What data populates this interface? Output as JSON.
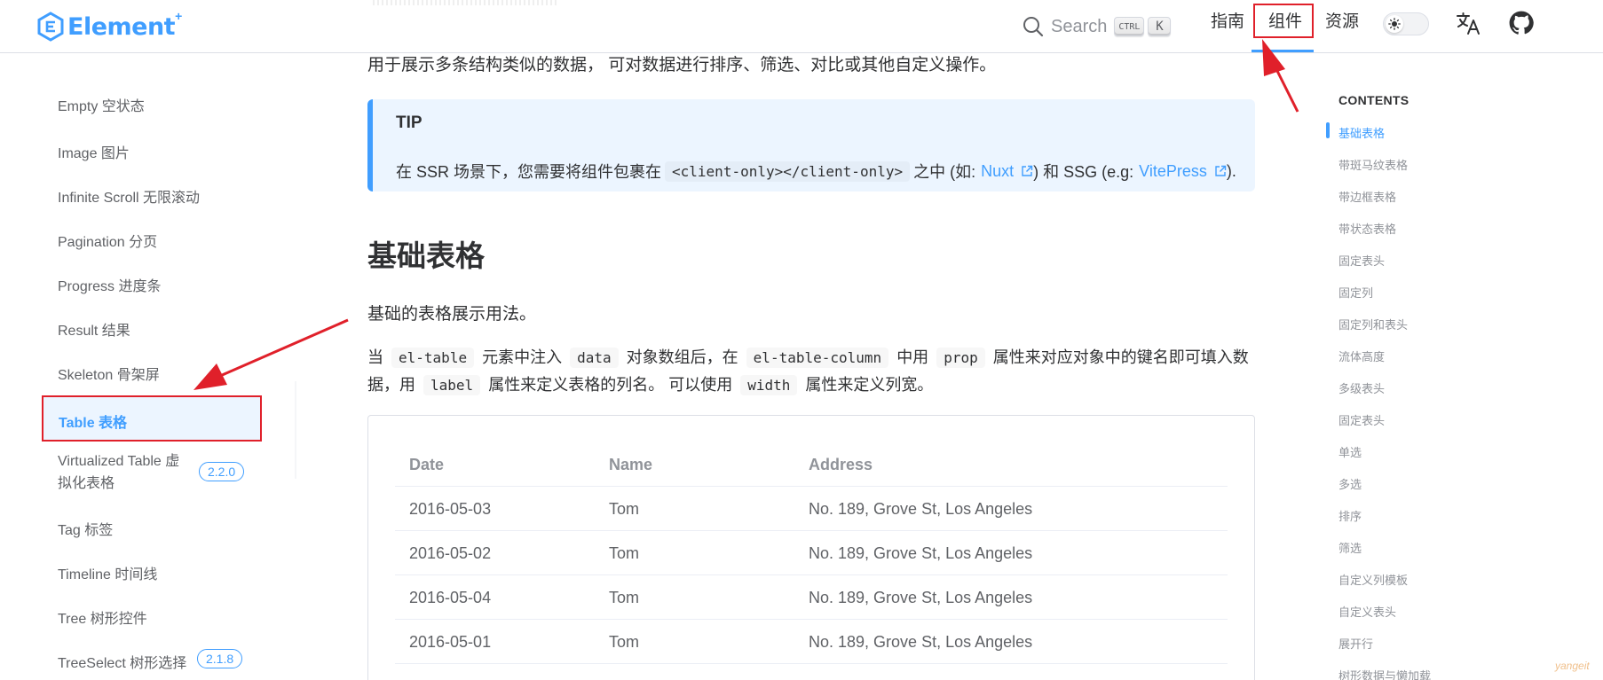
{
  "navbar": {
    "logo_text": "Element",
    "logo_plus": "+",
    "search_label": "Search",
    "kbd_ctrl": "CTRL",
    "kbd_k": "K",
    "links": [
      "指南",
      "组件",
      "资源"
    ],
    "active_link": "组件",
    "icons": [
      "sun-icon",
      "translate-icon",
      "github-icon"
    ]
  },
  "sidebar": {
    "items": [
      "Empty 空状态",
      "Image 图片",
      "Infinite Scroll 无限滚动",
      "Pagination 分页",
      "Progress 进度条",
      "Result 结果",
      "Skeleton 骨架屏",
      "Table 表格",
      "Virtualized Table 虚拟化表格",
      "Tag 标签",
      "Timeline 时间线",
      "Tree 树形控件",
      "TreeSelect 树形选择"
    ],
    "active": "Table 表格",
    "vt_line1": "Virtualized Table 虚",
    "vt_line2": "拟化表格",
    "vt_badge": "2.2.0",
    "treeselect_badge": "2.1.8"
  },
  "main": {
    "intro": "用于展示多条结构类似的数据， 可对数据进行排序、筛选、对比或其他自定义操作。",
    "tip": {
      "title": "TIP",
      "prefix": "在 SSR 场景下，您需要将组件包裹在",
      "code": "<client-only></client-only>",
      "middle": "之中 (如:",
      "link1": "Nuxt",
      "and_text": ") 和 SSG (e.g:",
      "link2": "VitePress",
      "suffix": ")."
    },
    "heading": "基础表格",
    "p1": "基础的表格展示用法。",
    "p2": {
      "t1": "当",
      "c1": "el-table",
      "t2": "元素中注入",
      "c2": "data",
      "t3": "对象数组后，在",
      "c3": "el-table-column",
      "t4": "中用",
      "c4": "prop",
      "t5": "属性来对应对象中的键名即可填入数据，用",
      "c5": "label",
      "t6": "属性来定义表格的列名。 可以使用",
      "c6": "width",
      "t7": "属性来定义列宽。"
    },
    "table": {
      "headers": [
        "Date",
        "Name",
        "Address"
      ],
      "rows": [
        [
          "2016-05-03",
          "Tom",
          "No. 189, Grove St, Los Angeles"
        ],
        [
          "2016-05-02",
          "Tom",
          "No. 189, Grove St, Los Angeles"
        ],
        [
          "2016-05-04",
          "Tom",
          "No. 189, Grove St, Los Angeles"
        ],
        [
          "2016-05-01",
          "Tom",
          "No. 189, Grove St, Los Angeles"
        ]
      ]
    }
  },
  "toc": {
    "title": "CONTENTS",
    "items": [
      "基础表格",
      "带斑马纹表格",
      "带边框表格",
      "带状态表格",
      "固定表头",
      "固定列",
      "固定列和表头",
      "流体高度",
      "多级表头",
      "固定表头",
      "单选",
      "多选",
      "排序",
      "筛选",
      "自定义列模板",
      "自定义表头",
      "展开行",
      "树形数据与懒加载"
    ],
    "active": "基础表格"
  },
  "watermark": "yangeit",
  "colors": {
    "accent": "#409eff",
    "annotation_red": "#e0202a"
  }
}
